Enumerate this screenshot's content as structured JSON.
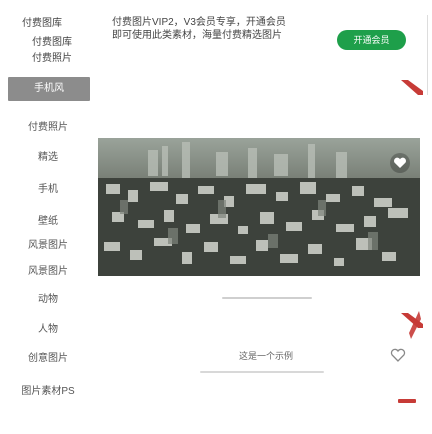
{
  "sidebar": {
    "top_category": "付费图库",
    "category_a": "付费图库",
    "category_b": "付费照片",
    "active_item": "手机风",
    "items": [
      {
        "label": "付费照片"
      },
      {
        "label": "精选"
      },
      {
        "label": "手机"
      },
      {
        "label": "壁纸"
      },
      {
        "label": "风景图片"
      },
      {
        "label": "风景图片"
      },
      {
        "label": "动物"
      },
      {
        "label": "人物"
      },
      {
        "label": "创意图片"
      },
      {
        "label": "图片素材PS"
      }
    ]
  },
  "banner": {
    "line1": "付费图片VIP2，V3会员专享，开通会员",
    "line2": "即可使用此类素材，海量付费精选图片",
    "vip_button": "开通会员"
  },
  "card2": {
    "title": "这是一个示例"
  },
  "colors": {
    "vip_green": "#1e9f4a",
    "mark_red": "#c73b37",
    "sidebar_active": "#8c8c8c"
  }
}
